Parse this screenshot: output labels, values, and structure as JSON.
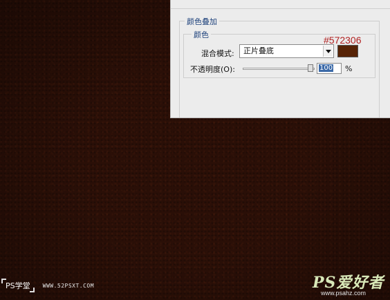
{
  "dialog": {
    "section_title": "颜色叠加",
    "group_title": "颜色",
    "blend_mode_label": "混合模式:",
    "blend_mode_value": "正片叠底",
    "color_swatch": "#572306",
    "opacity_label": "不透明度(O):",
    "opacity_value": "100",
    "opacity_unit": "%",
    "opacity_level": 100
  },
  "annotation": {
    "hex": "#572306",
    "color": "#b02020"
  },
  "watermark": {
    "left_label": "PS学堂",
    "left_url": "WWW.52PSXT.COM",
    "right_logo": "PS爱好者",
    "right_url": "www.psahz.com"
  },
  "background": {
    "color": "#2a0f07"
  }
}
